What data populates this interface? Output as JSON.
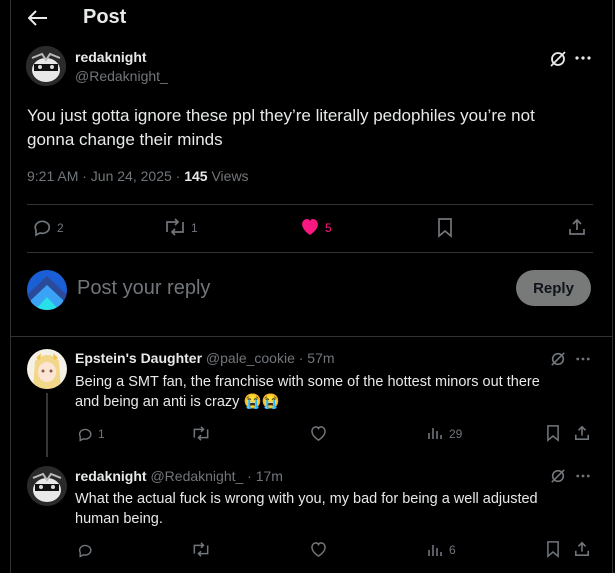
{
  "header": {
    "title": "Post"
  },
  "post": {
    "display_name": "redaknight",
    "handle": "@Redaknight_",
    "text_line1": "You just gotta ignore these ppl they’re literally pedophiles you’re not",
    "text_line2": "gonna change their minds",
    "time": "9:21 AM · Jun 24, 2025 · ",
    "views_count": "145",
    "views_label": " Views",
    "replies": "2",
    "reposts": "1",
    "likes": "5"
  },
  "composer": {
    "placeholder": "Post your reply",
    "reply_button": "Reply"
  },
  "replies": [
    {
      "display_name": "Epstein's Daughter",
      "handle": "@pale_cookie",
      "time": " · 57m",
      "text_line1": "Being a SMT fan, the franchise with some of the hottest minors out there",
      "text_line2": "and being an anti is crazy",
      "emoji": "😭😭",
      "replies": "1",
      "reposts": "",
      "views": "29"
    },
    {
      "display_name": "redaknight",
      "handle": "@Redaknight_",
      "time": " · 17m",
      "text_line1": "What the actual fuck is wrong with you, my bad for being a well adjusted",
      "text_line2": "human being.",
      "replies": "",
      "reposts": "",
      "views": "6"
    }
  ],
  "colors": {
    "like_pink": "#f91880",
    "reply_button_bg": "#787a7a",
    "accent_blue": "#1d9bf0"
  }
}
